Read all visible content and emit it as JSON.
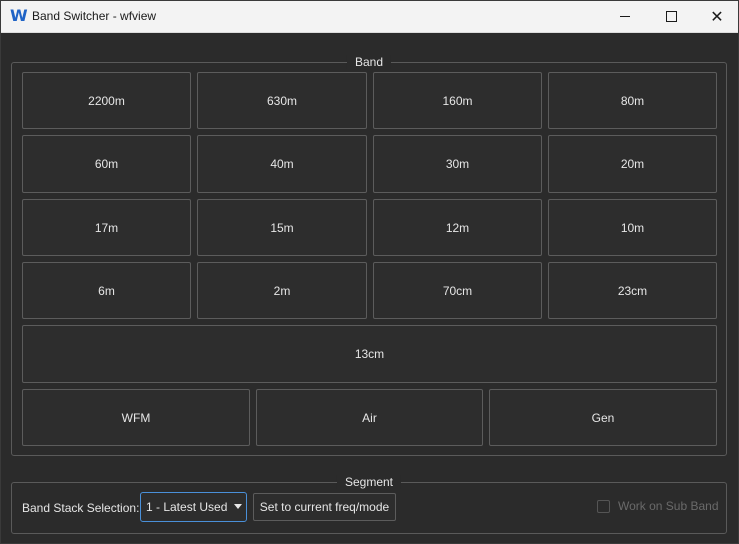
{
  "window": {
    "title": "Band Switcher - wfview",
    "app_icon": "W"
  },
  "band": {
    "title": "Band",
    "buttons": [
      "2200m",
      "630m",
      "160m",
      "80m",
      "60m",
      "40m",
      "30m",
      "20m",
      "17m",
      "15m",
      "12m",
      "10m",
      "6m",
      "2m",
      "70cm",
      "23cm",
      "13cm",
      "WFM",
      "Air",
      "Gen"
    ]
  },
  "segment": {
    "title": "Segment",
    "band_stack_label": "Band Stack Selection:",
    "band_stack_value": "1 - Latest Used",
    "set_button": "Set to current freq/mode",
    "sub_band_label": "Work on Sub Band",
    "sub_band_checked": false
  },
  "colors": {
    "background": "#2b2b2b",
    "accent": "#4a90d9",
    "icon": "#1f63c6"
  }
}
